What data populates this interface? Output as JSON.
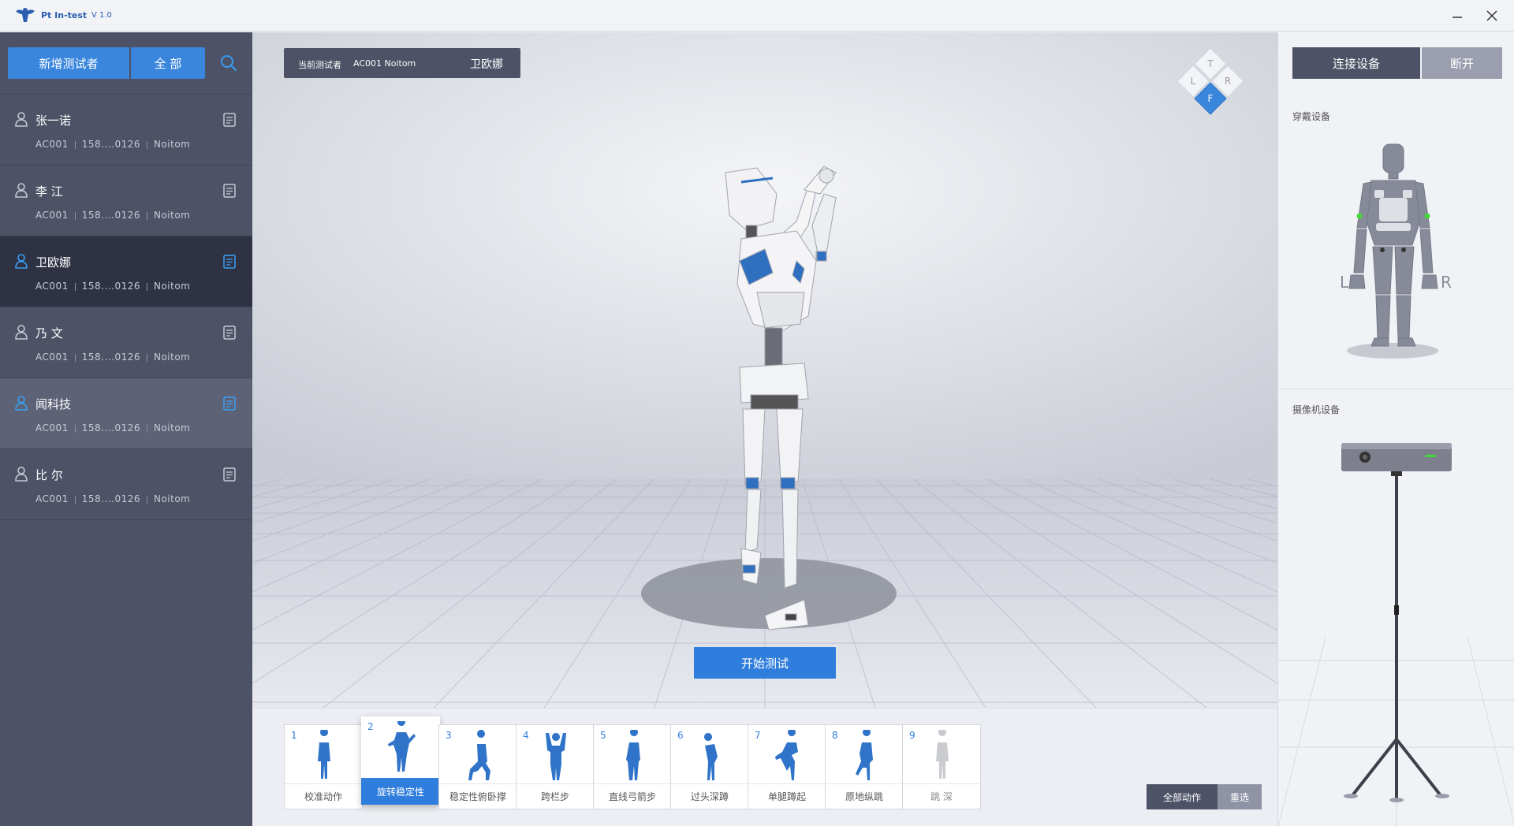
{
  "titlebar": {
    "app_name": "Pt In-test",
    "version": "V 1.0"
  },
  "sidebar": {
    "add_tester_label": "新增测试者",
    "all_label": "全 部",
    "testers": [
      {
        "name": "张一诺",
        "id": "AC001",
        "phone": "158....0126",
        "org": "Noitom",
        "state": "normal"
      },
      {
        "name": "李 江",
        "id": "AC001",
        "phone": "158....0126",
        "org": "Noitom",
        "state": "normal"
      },
      {
        "name": "卫欧娜",
        "id": "AC001",
        "phone": "158....0126",
        "org": "Noitom",
        "state": "active"
      },
      {
        "name": "乃 文",
        "id": "AC001",
        "phone": "158....0126",
        "org": "Noitom",
        "state": "normal"
      },
      {
        "name": "闻科技",
        "id": "AC001",
        "phone": "158....0126",
        "org": "Noitom",
        "state": "hover"
      },
      {
        "name": "比 尔",
        "id": "AC001",
        "phone": "158....0126",
        "org": "Noitom",
        "state": "normal"
      }
    ]
  },
  "viewport": {
    "current_label": "当前测试者",
    "current_id": "AC001  Noitom",
    "current_name": "卫欧娜",
    "view_cube": {
      "top": "T",
      "left": "L",
      "right": "R",
      "front": "F",
      "active": "F"
    },
    "start_test_label": "开始测试"
  },
  "actions": {
    "items": [
      {
        "num": "1",
        "label": "校准动作",
        "state": "normal"
      },
      {
        "num": "2",
        "label": "旋转稳定性",
        "state": "selected"
      },
      {
        "num": "3",
        "label": "稳定性俯卧撑",
        "state": "normal"
      },
      {
        "num": "4",
        "label": "跨栏步",
        "state": "normal"
      },
      {
        "num": "5",
        "label": "直线弓箭步",
        "state": "normal"
      },
      {
        "num": "6",
        "label": "过头深蹲",
        "state": "normal"
      },
      {
        "num": "7",
        "label": "单腿蹲起",
        "state": "normal"
      },
      {
        "num": "8",
        "label": "原地纵跳",
        "state": "normal"
      },
      {
        "num": "9",
        "label": "跳 深",
        "state": "disabled"
      }
    ],
    "all_actions_label": "全部动作",
    "reselect_label": "重选"
  },
  "right_panel": {
    "connect_label": "连接设备",
    "disconnect_label": "断开",
    "wearable_label": "穿戴设备",
    "body_left": "L",
    "body_right": "R",
    "camera_label": "摄像机设备"
  },
  "colors": {
    "accent": "#2f7ddc",
    "sidebar": "#4d5266",
    "sidebar_active": "#2e3243",
    "sensor_on": "#44d63a"
  }
}
